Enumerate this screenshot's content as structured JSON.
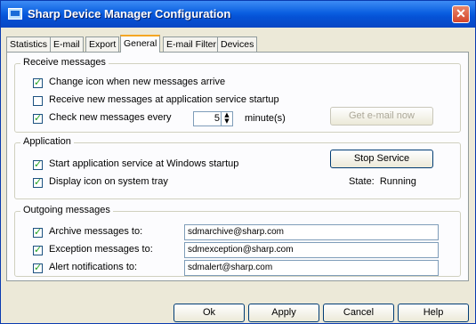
{
  "window": {
    "title": "Sharp Device Manager Configuration",
    "close_glyph": "✕"
  },
  "tabs": [
    {
      "label": "Statistics"
    },
    {
      "label": "E-mail"
    },
    {
      "label": "Export"
    },
    {
      "label": "General",
      "active": true
    },
    {
      "label": "E-mail Filter"
    },
    {
      "label": "Devices"
    }
  ],
  "receive": {
    "group_label": "Receive messages",
    "change_icon_label": "Change icon when new messages arrive",
    "change_icon_checked": true,
    "receive_startup_label": "Receive new messages at application service startup",
    "receive_startup_checked": false,
    "check_every_label": "Check new messages every",
    "check_every_checked": true,
    "check_every_value": "5",
    "minutes_label": "minute(s)",
    "get_email_button": "Get e-mail now"
  },
  "application": {
    "group_label": "Application",
    "start_service_label": "Start application service at Windows startup",
    "start_service_checked": true,
    "display_icon_label": "Display icon on system tray",
    "display_icon_checked": true,
    "stop_service_button": "Stop Service",
    "state_text": "State:  Running"
  },
  "outgoing": {
    "group_label": "Outgoing messages",
    "archive_label": "Archive messages to:",
    "archive_checked": true,
    "archive_value": "sdmarchive@sharp.com",
    "exception_label": "Exception messages to:",
    "exception_checked": true,
    "exception_value": "sdmexception@sharp.com",
    "alert_label": "Alert notifications to:",
    "alert_checked": true,
    "alert_value": "sdmalert@sharp.com"
  },
  "buttons": {
    "ok": "Ok",
    "apply": "Apply",
    "cancel": "Cancel",
    "help": "Help"
  }
}
